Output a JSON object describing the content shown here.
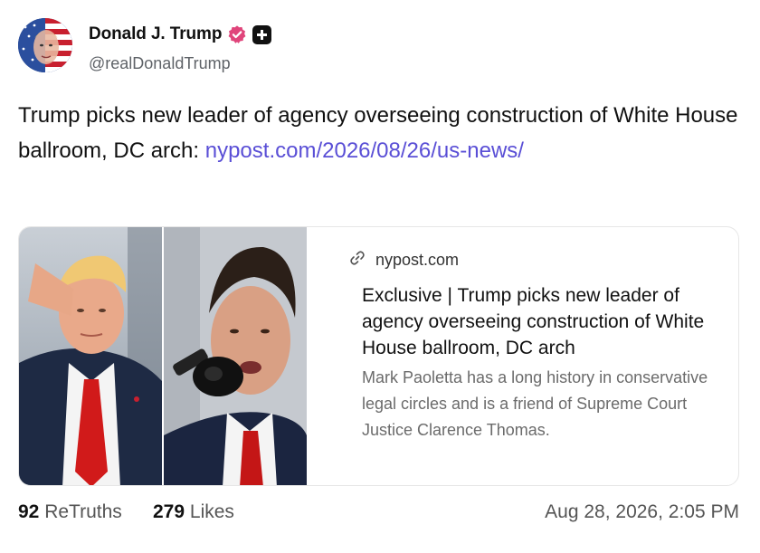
{
  "user": {
    "display_name": "Donald J. Trump",
    "handle": "@realDonaldTrump",
    "verified_color": "#e0457b"
  },
  "post": {
    "text": "Trump picks new leader of agency overseeing construction of White House ballroom, DC arch: ",
    "link": "nypost.com/2026/08/26/us-news/",
    "link_color": "#5a4fd6"
  },
  "link_card": {
    "domain": "nypost.com",
    "title": "Exclusive | Trump picks new leader of agency overseeing construction of White House ballroom, DC arch",
    "description": "Mark Paoletta has a long history in conservative legal circles and is a friend of Supreme Court Justice Clarence Thomas.",
    "icons": {
      "domain": "link-icon"
    }
  },
  "stats": {
    "retruths_count": "92",
    "retruths_label": "ReTruths",
    "likes_count": "279",
    "likes_label": "Likes",
    "timestamp": "Aug 28, 2026, 2:05 PM"
  }
}
